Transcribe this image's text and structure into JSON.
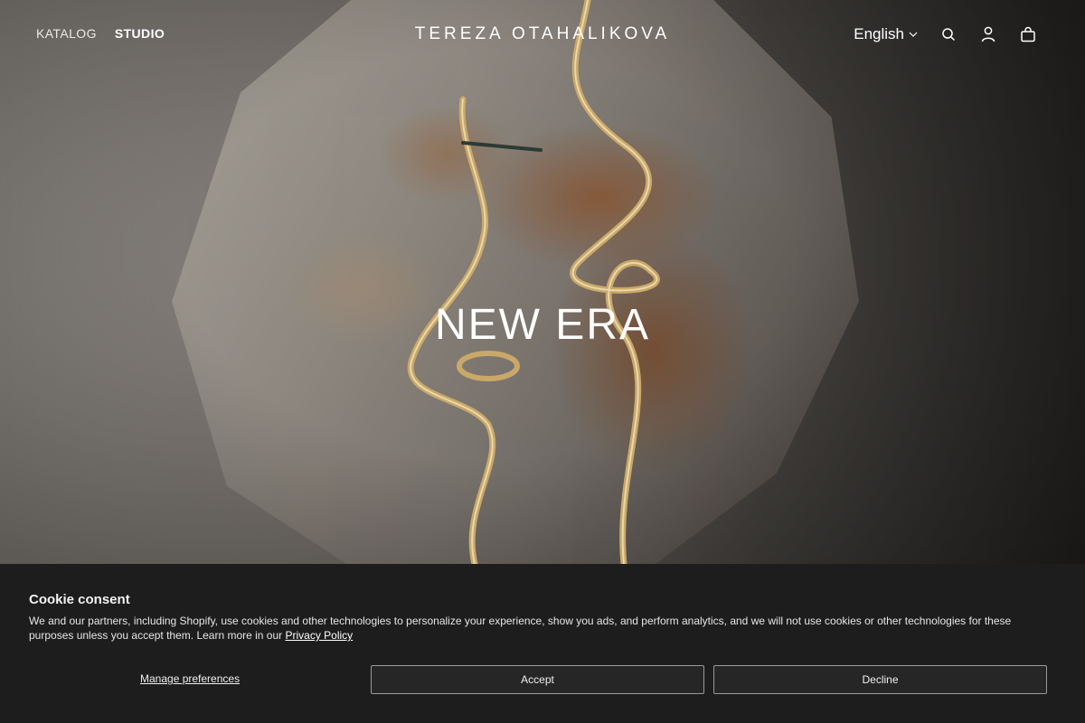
{
  "header": {
    "nav": [
      {
        "label": "KATALOG"
      },
      {
        "label": "STUDIO"
      }
    ],
    "brand": "TEREZA OTAHALIKOVA",
    "language": "English",
    "icons": [
      "search-icon",
      "account-icon",
      "cart-icon"
    ]
  },
  "hero": {
    "title": "NEW ERA"
  },
  "cookie": {
    "title": "Cookie consent",
    "text": "We and our partners, including Shopify, use cookies and other technologies to personalize your experience, show you ads, and perform analytics, and we will not use cookies or other technologies for these purposes unless you accept them. Learn more in our",
    "privacy_link": "Privacy Policy",
    "manage_label": "Manage preferences",
    "accept_label": "Accept",
    "decline_label": "Decline"
  }
}
